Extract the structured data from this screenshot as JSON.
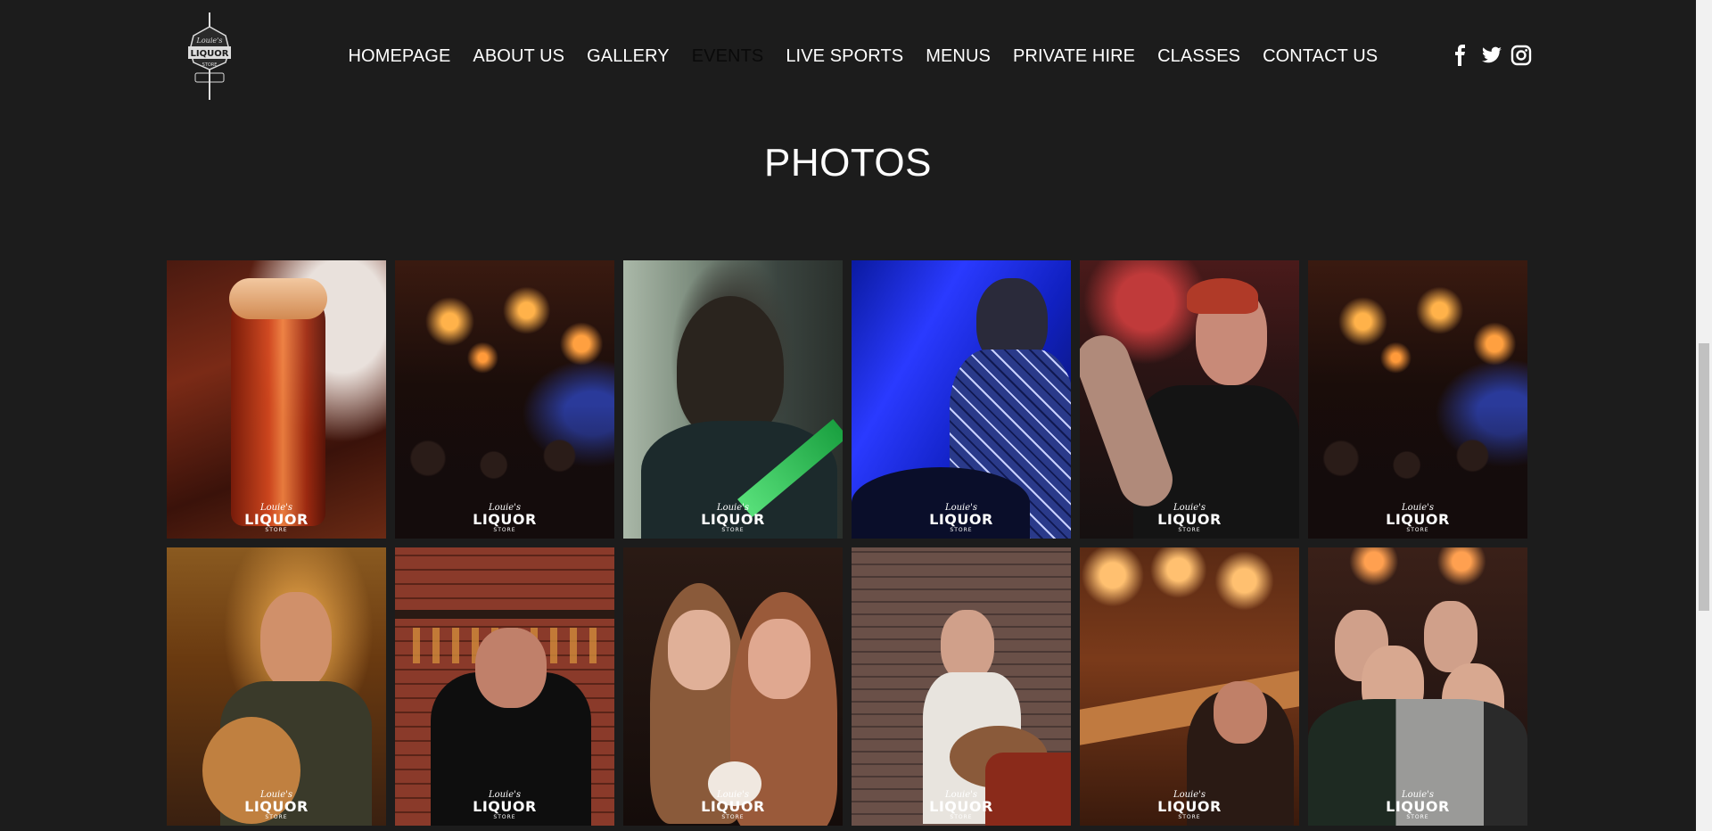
{
  "nav": {
    "items": [
      {
        "label": "HOMEPAGE",
        "active": false
      },
      {
        "label": "ABOUT US",
        "active": false
      },
      {
        "label": "GALLERY",
        "active": false
      },
      {
        "label": "EVENTS",
        "active": true
      },
      {
        "label": "LIVE SPORTS",
        "active": false
      },
      {
        "label": "MENUS",
        "active": false
      },
      {
        "label": "PRIVATE HIRE",
        "active": false
      },
      {
        "label": "CLASSES",
        "active": false
      },
      {
        "label": "CONTACT US",
        "active": false
      }
    ]
  },
  "logo": {
    "top": "Louie's",
    "main": "LIQUOR",
    "sub": "STORE"
  },
  "social": [
    "facebook-icon",
    "twitter-icon",
    "instagram-icon"
  ],
  "page": {
    "title": "PHOTOS"
  },
  "watermark": {
    "script": "Louie's",
    "big": "LIQUOR",
    "small": "STORE"
  },
  "photos": [
    {
      "scene": "pint-glass"
    },
    {
      "scene": "bar-crowd-lamps"
    },
    {
      "scene": "singer-green"
    },
    {
      "scene": "drummer-blue"
    },
    {
      "scene": "man-tattoo-red"
    },
    {
      "scene": "bar-crowd-lamps"
    },
    {
      "scene": "guitarist-warm"
    },
    {
      "scene": "bartender-bricks"
    },
    {
      "scene": "two-women"
    },
    {
      "scene": "guitarist-bricks"
    },
    {
      "scene": "bar-counter"
    },
    {
      "scene": "group-men"
    }
  ]
}
